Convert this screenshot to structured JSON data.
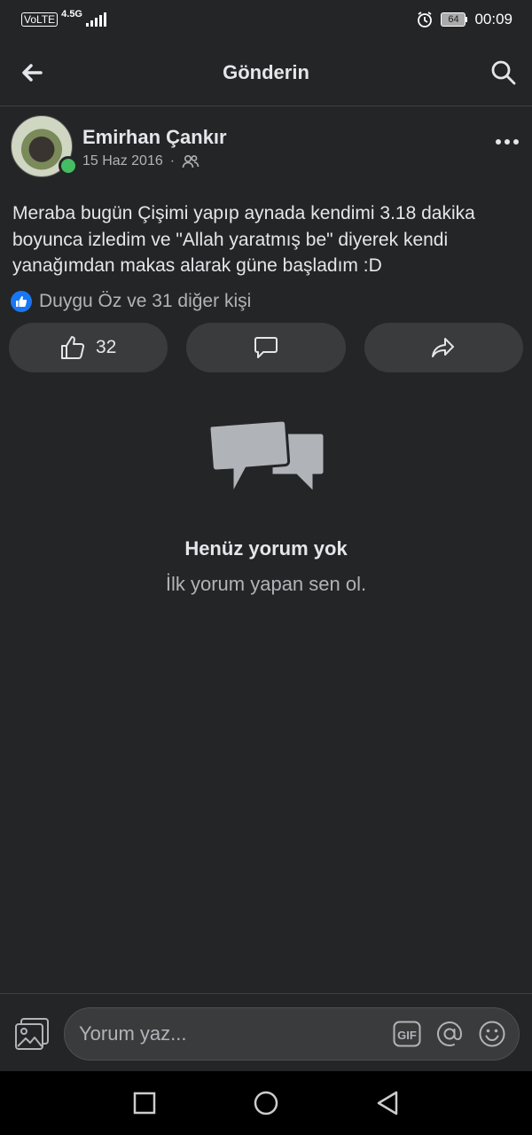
{
  "status_bar": {
    "volte": "VoLTE",
    "network": "4.5G",
    "battery": "64",
    "time": "00:09"
  },
  "header": {
    "title": "Gönderin"
  },
  "post": {
    "author": "Emirhan Çankır",
    "date": "15 Haz 2016",
    "separator": "·",
    "text": "Meraba bugün Çişimi yapıp aynada kendimi 3.18 dakika boyunca izledim ve \"Allah yaratmış be\" diyerek kendi yanağımdan makas alarak güne başladım :D",
    "reactions_summary": "Duygu Öz ve 31 diğer kişi",
    "like_count": "32"
  },
  "comments": {
    "empty_title": "Henüz yorum yok",
    "empty_subtitle": "İlk yorum yapan sen ol."
  },
  "composer": {
    "placeholder": "Yorum yaz...",
    "gif_label": "GIF"
  },
  "colors": {
    "background": "#242526",
    "like_blue": "#1877f2",
    "online_green": "#45bd62"
  }
}
